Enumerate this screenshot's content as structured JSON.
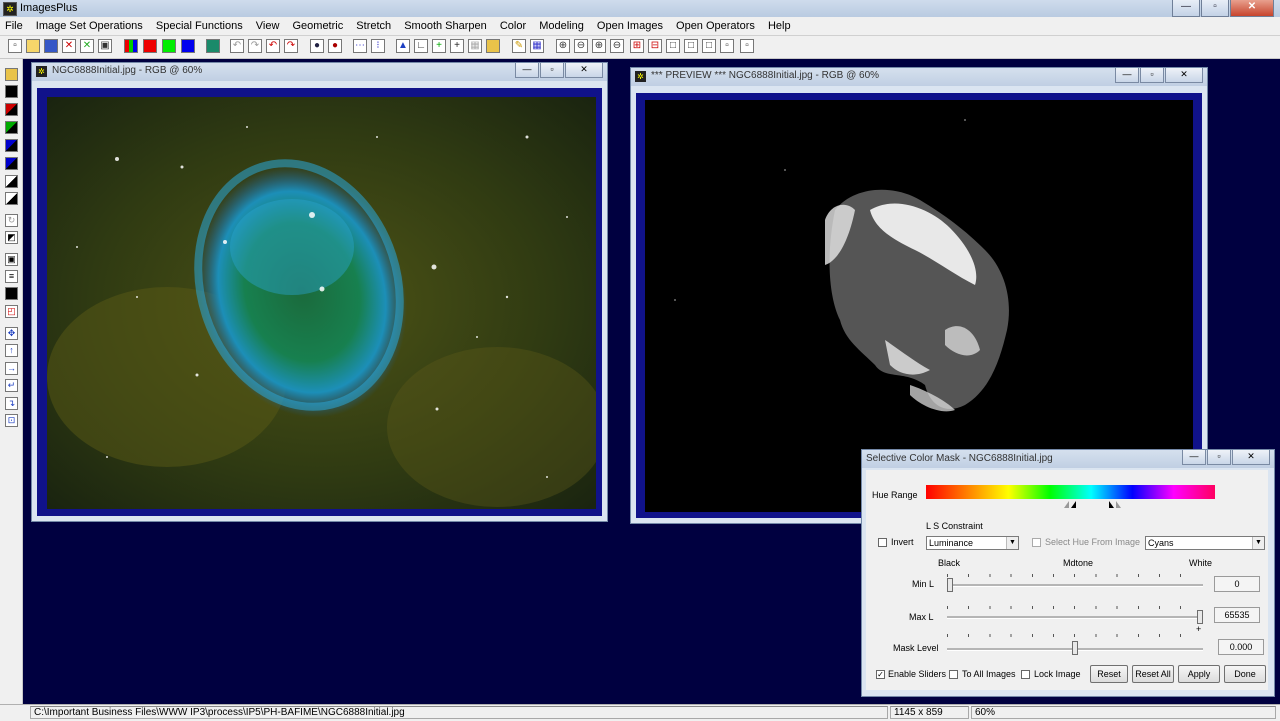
{
  "app": {
    "title": "ImagesPlus"
  },
  "menu": [
    "File",
    "Image Set Operations",
    "Special Functions",
    "View",
    "Geometric",
    "Stretch",
    "Smooth Sharpen",
    "Color",
    "Modeling",
    "Open Images",
    "Open Operators",
    "Help"
  ],
  "window_buttons": {
    "minimize": "—",
    "maximize": "▫",
    "close": "✕"
  },
  "image_window": {
    "title": "NGC6888Initial.jpg - RGB @ 60%"
  },
  "preview_window": {
    "title": "*** PREVIEW *** NGC6888Initial.jpg - RGB @ 60%"
  },
  "dialog": {
    "title": "Selective Color Mask - NGC6888Initial.jpg",
    "hue_range_label": "Hue Range",
    "ls_constraint_label": "L S Constraint",
    "invert_label": "Invert",
    "invert_checked": false,
    "constraint_value": "Luminance",
    "select_hue_label": "Select Hue From Image",
    "hue_select_value": "Cyans",
    "black_label": "Black",
    "midtone_label": "Mdtone",
    "white_label": "White",
    "min_l_label": "Min L",
    "min_l_value": "0",
    "max_l_label": "Max L",
    "max_l_value": "65535",
    "mask_level_label": "Mask Level",
    "mask_level_value": "0.000",
    "enable_sliders_label": "Enable Sliders",
    "enable_sliders_checked": true,
    "to_all_images_label": "To All Images",
    "lock_image_label": "Lock Image",
    "reset_label": "Reset",
    "reset_all_label": "Reset All",
    "apply_label": "Apply",
    "done_label": "Done",
    "checkmark": "✓",
    "plus_mark": "+"
  },
  "status": {
    "path": "C:\\Important Business Files\\WWW IP3\\process\\IP5\\PH-BAFIME\\NGC6888Initial.jpg",
    "dimensions": "1145 x 859",
    "zoom": "60%"
  }
}
